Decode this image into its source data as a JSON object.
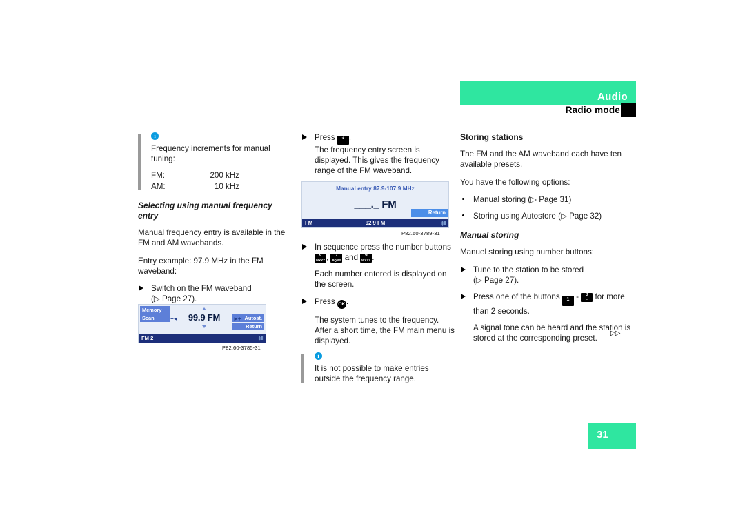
{
  "header": {
    "title": "Audio",
    "subtitle": "Radio mode",
    "accent_color": "#2fe6a0"
  },
  "page_number": "31",
  "continue_marker": "▷▷",
  "left_column": {
    "note": {
      "icon": "info-icon",
      "line1": "Frequency increments for manual tuning:",
      "table": [
        {
          "label": "FM:",
          "value": "200 kHz"
        },
        {
          "label": "AM:",
          "value": "10 kHz"
        }
      ]
    },
    "heading": "Selecting using manual frequency entry",
    "para1": "Manual frequency entry is available in the FM and AM wavebands.",
    "para2": "Entry example: 97.9 MHz in the FM waveband:",
    "step1": "Switch on the FM waveband",
    "step1_ref": "(▷ Page 27).",
    "figure": {
      "caption": "P82.60-3785-31",
      "memory_label": "Memory",
      "scan_label": "Scan",
      "autostore_label": "Autost.",
      "return_label": "Return",
      "frequency": "99.9 FM",
      "prev_label": "−◄",
      "next_label": "►+",
      "band": "FM 2",
      "signal": "ıl̩ıll"
    }
  },
  "middle_column": {
    "step1_lead": "Press",
    "step1_key": "*",
    "step1_tail": ".",
    "step1_body": "The frequency entry screen is displayed. This gives the frequency range of the FM waveband.",
    "figure": {
      "caption": "P82.60-3789-31",
      "title": "Manual entry 87.9-107.9 MHz",
      "entry": "___._ FM",
      "return_label": "Return",
      "band": "FM",
      "frequency": "92.9 FM",
      "signal": "ıl̩ıll"
    },
    "step2_lead": "In sequence press the number buttons",
    "step2_keys": [
      {
        "num": "9",
        "letters": "WXYZ"
      },
      {
        "num": "7",
        "letters": "PQRS"
      },
      {
        "num": "9",
        "letters": "WXYZ"
      }
    ],
    "step2_conj": "and",
    "step2_tail": ".",
    "step2_body": "Each number entered is displayed on the screen.",
    "step3_lead": "Press",
    "step3_key": "OK",
    "step3_tail": ".",
    "step3_body": "The system tunes to the frequency. After a short time, the FM main menu is displayed.",
    "note": {
      "icon": "info-icon",
      "text": "It is not possible to make entries outside the frequency range."
    }
  },
  "right_column": {
    "heading1": "Storing stations",
    "para1": "The FM and the AM waveband each have ten available presets.",
    "para2": "You have the following options:",
    "bullets": [
      "Manual storing (▷ Page 31)",
      "Storing using Autostore (▷ Page 32)"
    ],
    "heading2": "Manual storing",
    "para3": "Manuel storing using number buttons:",
    "step1": "Tune to the station to be stored",
    "step1_ref": "(▷ Page 27).",
    "step2_lead": "Press one of the buttons",
    "step2_key_first": "1",
    "step2_dash": "-",
    "step2_key_last_num": "0",
    "step2_key_last_letters": "–",
    "step2_tail": "for more than 2 seconds.",
    "step2_body": "A signal tone can be heard and the station is stored at the corresponding preset."
  }
}
